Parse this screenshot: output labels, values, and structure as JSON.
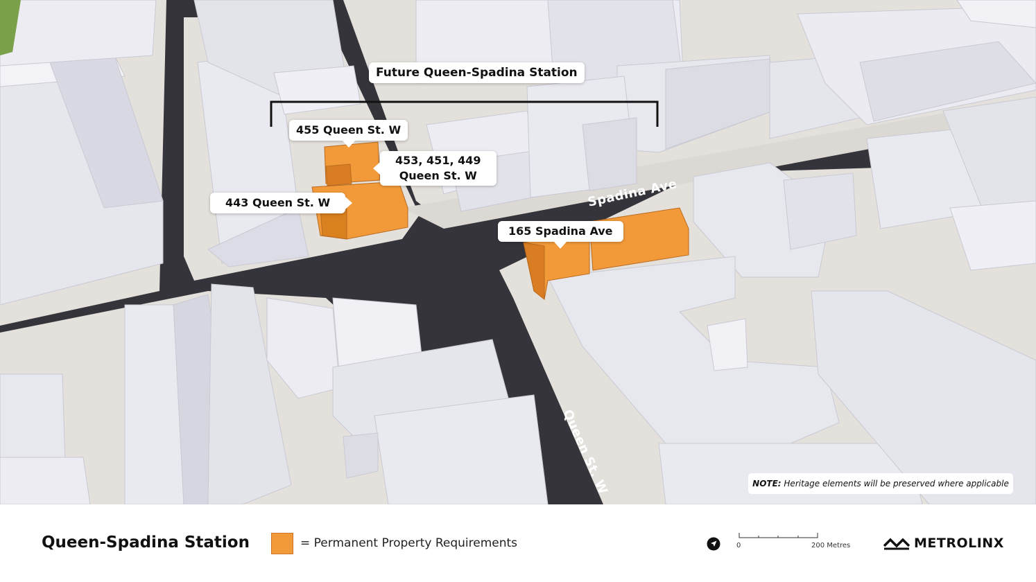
{
  "map": {
    "station_label": "Future Queen-Spadina Station",
    "callouts": [
      {
        "id": "455",
        "text": "455 Queen St. W"
      },
      {
        "id": "453",
        "line1": "453, 451, 449",
        "line2": "Queen St. W"
      },
      {
        "id": "443",
        "text": "443 Queen St. W"
      },
      {
        "id": "165",
        "text": "165 Spadina Ave"
      }
    ],
    "streets": {
      "spadina": "Spadina Ave",
      "queen": "Queen St. W"
    },
    "note_bold": "NOTE:",
    "note_text": " Heritage elements will be preserved where applicable"
  },
  "footer": {
    "title": "Queen-Spadina Station",
    "legend_label": "= Permanent Property Requirements",
    "scale_start": "0",
    "scale_end": "200 Metres",
    "brand": "METROLINX"
  },
  "colors": {
    "property": "#f29a3a",
    "road": "#34343a",
    "building": "#e8e8ee",
    "sidewalk": "#e4e0dc"
  },
  "icons": {
    "north_arrow": "compass-arrow-icon",
    "brand_mark": "metrolinx-logo-icon"
  }
}
